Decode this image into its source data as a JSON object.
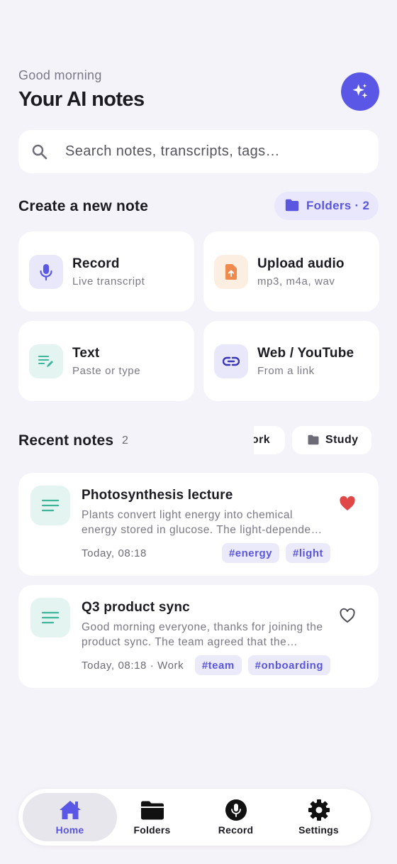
{
  "header": {
    "greeting": "Good morning",
    "title": "Your AI notes"
  },
  "search": {
    "placeholder": "Search notes, transcripts, tags…"
  },
  "create": {
    "title": "Create a new note",
    "folders_chip": "Folders · 2",
    "cards": [
      {
        "label": "Record",
        "sub": "Live transcript",
        "icon": "microphone-icon"
      },
      {
        "label": "Upload audio",
        "sub": "mp3, m4a, wav",
        "icon": "upload-file-icon"
      },
      {
        "label": "Text",
        "sub": "Paste or type",
        "icon": "edit-text-icon"
      },
      {
        "label": "Web / YouTube",
        "sub": "From a link",
        "icon": "link-icon"
      }
    ]
  },
  "recent": {
    "title": "Recent notes",
    "count": "2",
    "filters": [
      "ork",
      "Study"
    ]
  },
  "notes": [
    {
      "title": "Photosynthesis lecture",
      "body": "Plants convert light energy into chemical energy stored in glucose. The light-dependent reactions take place in the thylakoid membranes.",
      "meta": "Today, 08:18",
      "tags": [
        "#energy",
        "#light"
      ],
      "favorite": true
    },
    {
      "title": "Q3 product sync",
      "body": "Good morning everyone, thanks for joining the product sync. The team agreed that the onboarding flow needs another pass.",
      "meta": "Today, 08:18 · Work",
      "tags": [
        "#team",
        "#onboarding"
      ],
      "favorite": false
    }
  ],
  "tabbar": {
    "home": "Home",
    "folders": "Folders",
    "record": "Record",
    "settings": "Settings"
  },
  "colors": {
    "accent": "#5b57e6",
    "background": "#f4f3f9",
    "heart_active": "#e04848",
    "teal_icon": "#3fb59a",
    "orange_icon": "#ef8a4c"
  }
}
